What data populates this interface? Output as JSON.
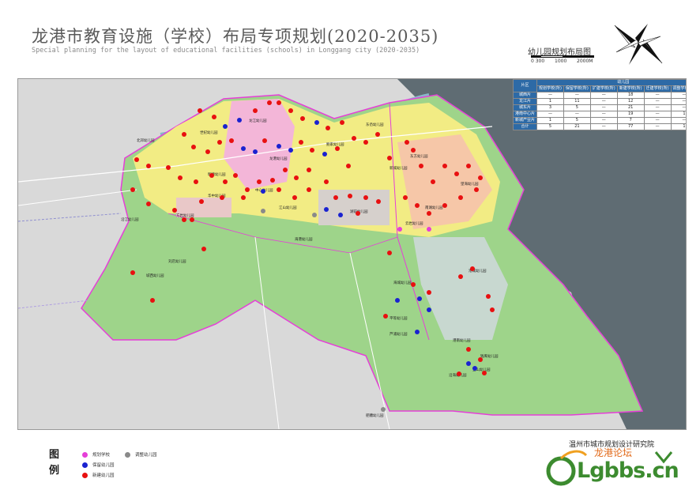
{
  "title": "龙港市教育设施（学校）布局专项规划(2020-2035)",
  "subtitle": "Special planning for the layout of educational facilities (schools) in Longgang city (2020-2035)",
  "map_name": "幼儿园规划布局图",
  "scale": {
    "labels": [
      "0 300",
      "1000",
      "2000M"
    ]
  },
  "table": {
    "header_group": "幼儿园",
    "columns": [
      "片区",
      "规划学校(所)",
      "保留学校(所)",
      "扩建学校(所)",
      "新建学校(所)",
      "迁建学校(所)",
      "调整学校(所)",
      "小计"
    ],
    "rows": [
      [
        "城西片",
        "—",
        "—",
        "—",
        "18",
        "—",
        "—",
        "18"
      ],
      [
        "龙江片",
        "1",
        "11",
        "—",
        "12",
        "—",
        "—",
        "24"
      ],
      [
        "城东片",
        "3",
        "5",
        "—",
        "21",
        "—",
        "—",
        "29"
      ],
      [
        "港南中心片",
        "—",
        "—",
        "—",
        "19",
        "—",
        "1",
        "20"
      ],
      [
        "新城产业片",
        "1",
        "5",
        "—",
        "7",
        "—",
        "—",
        "13"
      ],
      [
        "合计",
        "5",
        "21",
        "—",
        "77",
        "—",
        "1",
        "104"
      ]
    ]
  },
  "map_labels": [
    "刘店幼儿园",
    "城西幼儿园",
    "港南幼儿园",
    "龙江幼儿园",
    "东岙幼儿园",
    "鲍家幼儿园",
    "新城幼儿园",
    "湖前幼儿园",
    "江山幼儿园",
    "沿江幼儿园",
    "明德幼儿园",
    "龙港幼儿园",
    "世纪幼儿园",
    "东方幼儿园",
    "望海幼儿园",
    "港城幼儿园",
    "北郊幼儿园",
    "海城幼儿园",
    "平等幼儿园",
    "芦浦幼儿园",
    "钱库幼儿园",
    "宜山幼儿园",
    "沿海幼儿园",
    "舥艚幼儿园",
    "海港幼儿园",
    "云岩幼儿园",
    "南湖幼儿园",
    "中心幼儿园",
    "华中幼儿园",
    "方岩幼儿园"
  ],
  "legend": {
    "title": "图例",
    "items": [
      {
        "label": "规划学校",
        "color": "#e53fd8"
      },
      {
        "label": "保留幼儿园",
        "color": "#1a22d0"
      },
      {
        "label": "新建幼儿园",
        "color": "#e81010"
      },
      {
        "label": "调整幼儿园",
        "color": "#8a8a8a"
      }
    ]
  },
  "institute": "温州市城市规划设计研究院",
  "watermark": {
    "text": "Lgbbs.cn",
    "cn": "龙港论坛"
  },
  "colors": {
    "sea": "#5f6c73",
    "boundary": "#e53fd8",
    "suburb": "#8fcf7a",
    "urban": "#f4ee7a"
  }
}
